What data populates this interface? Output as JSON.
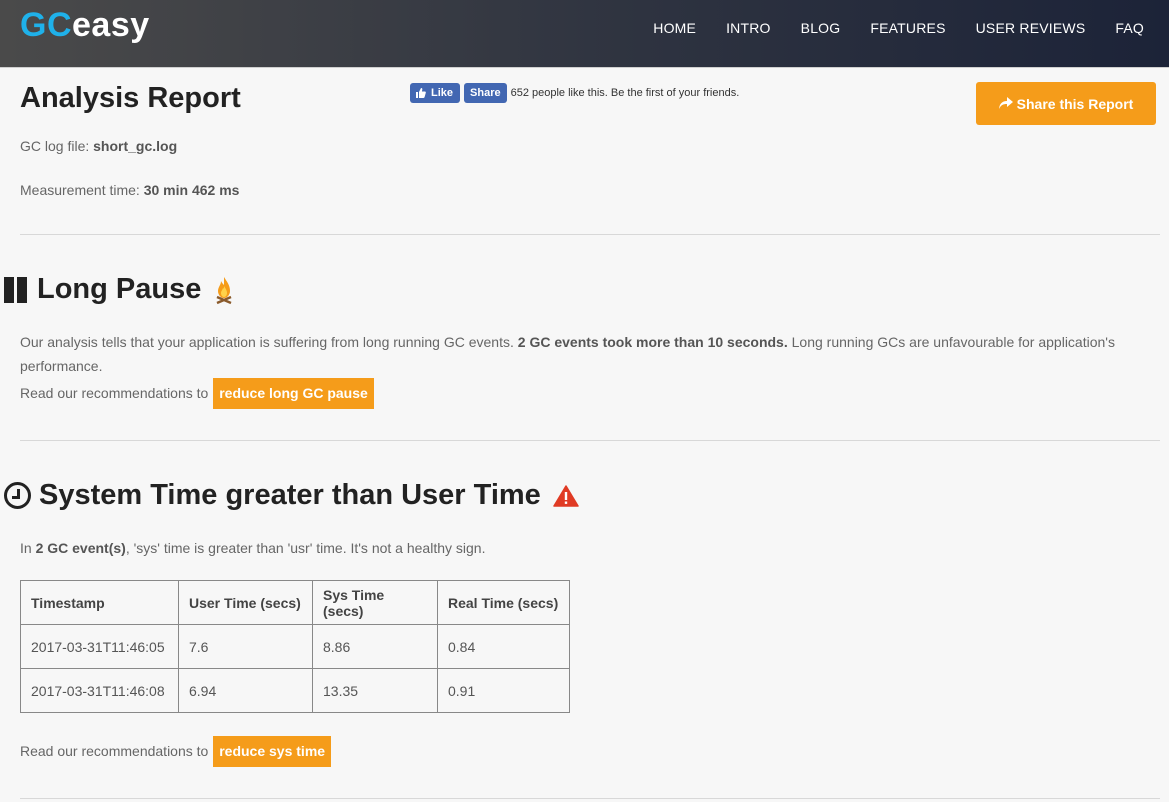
{
  "header": {
    "logo_gc": "GC",
    "logo_easy": "easy",
    "nav": [
      "HOME",
      "INTRO",
      "BLOG",
      "FEATURES",
      "USER REVIEWS",
      "FAQ"
    ]
  },
  "report": {
    "title": "Analysis Report",
    "fb_like": "Like",
    "fb_share": "Share",
    "fb_text": "652 people like this. Be the first of your friends.",
    "share_button": "Share this Report",
    "gc_log_label": "GC log file: ",
    "gc_log_value": "short_gc.log",
    "measure_label": "Measurement time: ",
    "measure_value": "30 min 462 ms"
  },
  "long_pause": {
    "title": "Long Pause",
    "text_a": "Our analysis tells that your application is suffering from long running GC events. ",
    "text_bold": "2 GC events took more than 10 seconds.",
    "text_b": " Long running GCs are unfavourable for application's performance.",
    "rec_text": "Read our recommendations to ",
    "rec_button": "reduce long GC pause"
  },
  "sys_time": {
    "title": "System Time greater than User Time",
    "text_a": "In ",
    "text_bold": "2 GC event(s)",
    "text_b": ", 'sys' time is greater than 'usr' time. It's not a healthy sign.",
    "columns": [
      "Timestamp",
      "User Time (secs)",
      "Sys Time (secs)",
      "Real Time (secs)"
    ],
    "rows": [
      [
        "2017-03-31T11:46:05",
        "7.6",
        "8.86",
        "0.84"
      ],
      [
        "2017-03-31T11:46:08",
        "6.94",
        "13.35",
        "0.91"
      ]
    ],
    "rec_text": "Read our recommendations to ",
    "rec_button": "reduce sys time"
  },
  "colors": {
    "accent": "#f59c1a",
    "logo_blue": "#1fb1ea",
    "facebook": "#4267b2",
    "warning": "#e03b24"
  },
  "icons": [
    "pause-icon",
    "fire-icon",
    "clock-icon",
    "warning-icon",
    "share-icon",
    "thumbs-up-icon"
  ]
}
